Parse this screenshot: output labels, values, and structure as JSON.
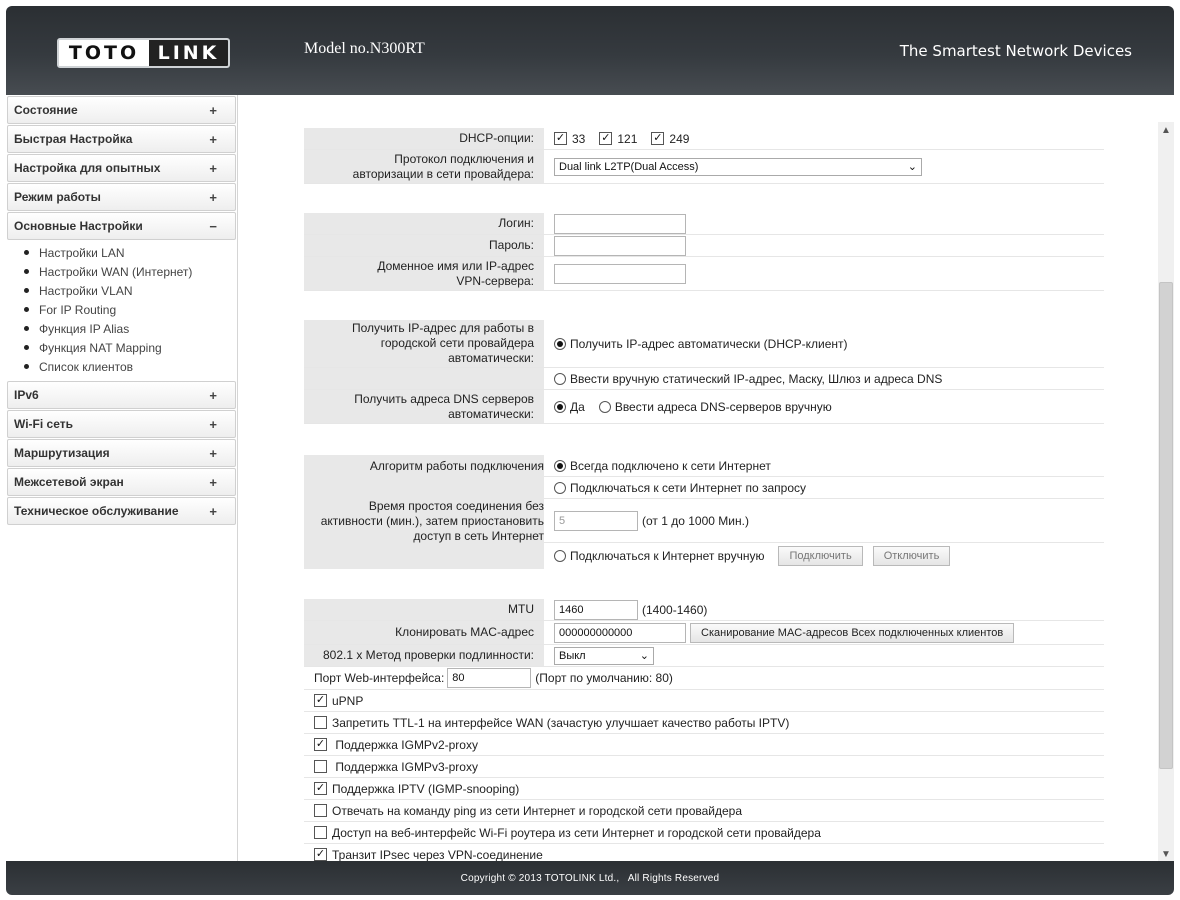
{
  "header": {
    "logo_left": "TOTO",
    "logo_right": "LINK",
    "model": "Model no.N300RT",
    "slogan": "The Smartest Network Devices"
  },
  "sidebar": {
    "items": [
      {
        "label": "Состояние",
        "sign": "+"
      },
      {
        "label": "Быстрая Настройка",
        "sign": "+"
      },
      {
        "label": "Настройка для опытных",
        "sign": "+"
      },
      {
        "label": "Режим работы",
        "sign": "+"
      },
      {
        "label": "Основные Настройки",
        "sign": "−"
      },
      {
        "label": "IPv6",
        "sign": "+"
      },
      {
        "label": "Wi-Fi сеть",
        "sign": "+"
      },
      {
        "label": "Маршрутизация",
        "sign": "+"
      },
      {
        "label": "Межсетевой экран",
        "sign": "+"
      },
      {
        "label": "Техническое обслуживание",
        "sign": "+"
      }
    ],
    "subitems": [
      "Настройки LAN",
      "Настройки WAN (Интернет)",
      "Настройки VLAN",
      "For IP Routing",
      "Функция IP Alias",
      "Функция NAT Mapping",
      "Список клиентов"
    ]
  },
  "form": {
    "dhcp_label": "DHCP-опции:",
    "dhcp_opts": [
      "33",
      "121",
      "249"
    ],
    "protocol_label_1": "Протокол подключения и",
    "protocol_label_2": "авторизации в сети провайдера:",
    "protocol_value": "Dual link L2TP(Dual Access)",
    "login_label": "Логин:",
    "password_label": "Пароль:",
    "vpn_label_1": "Доменное имя или IP-адрес",
    "vpn_label_2": "VPN-сервера:",
    "ip_label_1": "Получить IP-адрес для работы в",
    "ip_label_2": "городской сети провайдера",
    "ip_label_3": "автоматически:",
    "ip_auto": "Получить IP-адрес автоматически (DHCP-клиент)",
    "ip_static": "Ввести вручную статический IP-адрес, Маску, Шлюз и адреса DNS",
    "dns_label_1": "Получить адреса DNS серверов",
    "dns_label_2": "автоматически:",
    "dns_yes": "Да",
    "dns_manual": "Ввести адреса DNS-серверов вручную",
    "algo_label": "Алгоритм работы подключения",
    "algo_always": "Всегда подключено к сети Интернет",
    "algo_demand": "Подключаться к сети Интернет по запросу",
    "idle_label_1": "Время простоя соединения без",
    "idle_label_2": "активности (мин.), затем приостановить",
    "idle_label_3": "доступ в сеть Интернет",
    "idle_value": "5",
    "idle_hint": "(от 1 до 1000 Мин.)",
    "algo_manual": "Подключаться к Интернет вручную",
    "connect_btn": "Подключить",
    "disconnect_btn": "Отключить",
    "mtu_label": "MTU",
    "mtu_value": "1460",
    "mtu_hint": "(1400-1460)",
    "mac_label": "Клонировать MAC-адрес",
    "mac_value": "000000000000",
    "mac_scan_btn": "Сканирование MAC-адресов Всех подключенных клиентов",
    "auth_label": "802.1 х Метод проверки подлинности:",
    "auth_value": "Выкл",
    "web_port_label": "Порт Web-интерфейса:",
    "web_port_value": "80",
    "web_port_hint": "(Порт по умолчанию: 80)",
    "checks": [
      {
        "label": "uPNP",
        "checked": true
      },
      {
        "label": "Запретить TTL-1 на интерфейсе WAN (зачастую улучшает качество работы IPTV)",
        "checked": false
      },
      {
        "label": " Поддержка IGMPv2-proxy",
        "checked": true
      },
      {
        "label": " Поддержка IGMPv3-proxy",
        "checked": false
      },
      {
        "label": "Поддержка IPTV (IGMP-snooping)",
        "checked": true
      },
      {
        "label": "Отвечать на команду ping из сети Интернет и городской сети провайдера",
        "checked": false
      },
      {
        "label": "Доступ на веб-интерфейс Wi-Fi роутера из сети Интернет и городской сети провайдера",
        "checked": false
      },
      {
        "label": "Транзит IPsec через VPN-соединение",
        "checked": true
      }
    ]
  },
  "footer": {
    "copyright": "Copyright © 2013 TOTOLINK Ltd.,   All Rights Reserved"
  }
}
